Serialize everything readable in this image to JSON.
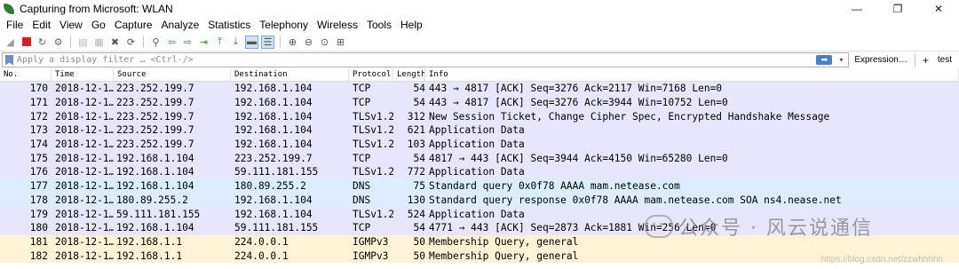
{
  "window": {
    "title": "Capturing from Microsoft: WLAN",
    "minimize": "—",
    "maximize": "❐",
    "close": "✕"
  },
  "menu": [
    "File",
    "Edit",
    "View",
    "Go",
    "Capture",
    "Analyze",
    "Statistics",
    "Telephony",
    "Wireless",
    "Tools",
    "Help"
  ],
  "toolbar_icons": [
    "shark-fin-icon",
    "stop-capture-icon",
    "restart-capture-icon",
    "capture-options-icon",
    "open-file-icon",
    "save-file-icon",
    "close-file-icon",
    "reload-icon",
    "find-packet-icon",
    "go-back-icon",
    "go-forward-icon",
    "go-to-packet-icon",
    "go-first-icon",
    "go-last-icon",
    "auto-scroll-icon",
    "colorize-icon",
    "zoom-in-icon",
    "zoom-out-icon",
    "zoom-normal-icon",
    "resize-columns-icon"
  ],
  "filter": {
    "placeholder": "Apply a display filter … <Ctrl-/>",
    "expression_label": "Expression…",
    "plus_label": "+",
    "test_label": "test"
  },
  "columns": {
    "no": "No.",
    "time": "Time",
    "source": "Source",
    "destination": "Destination",
    "protocol": "Protocol",
    "length": "Length",
    "info": "Info"
  },
  "packets": [
    {
      "no": "170",
      "time": "2018-12-1…",
      "source": "223.252.199.7",
      "destination": "192.168.1.104",
      "protocol": "TCP",
      "length": "54",
      "info": "443 → 4817 [ACK] Seq=3276 Ack=2117 Win=7168 Len=0",
      "color": "#e7e6ff"
    },
    {
      "no": "171",
      "time": "2018-12-1…",
      "source": "223.252.199.7",
      "destination": "192.168.1.104",
      "protocol": "TCP",
      "length": "54",
      "info": "443 → 4817 [ACK] Seq=3276 Ack=3944 Win=10752 Len=0",
      "color": "#e7e6ff"
    },
    {
      "no": "172",
      "time": "2018-12-1…",
      "source": "223.252.199.7",
      "destination": "192.168.1.104",
      "protocol": "TLSv1.2",
      "length": "312",
      "info": "New Session Ticket, Change Cipher Spec, Encrypted Handshake Message",
      "color": "#e7e6ff"
    },
    {
      "no": "173",
      "time": "2018-12-1…",
      "source": "223.252.199.7",
      "destination": "192.168.1.104",
      "protocol": "TLSv1.2",
      "length": "621",
      "info": "Application Data",
      "color": "#e7e6ff"
    },
    {
      "no": "174",
      "time": "2018-12-1…",
      "source": "223.252.199.7",
      "destination": "192.168.1.104",
      "protocol": "TLSv1.2",
      "length": "103",
      "info": "Application Data",
      "color": "#e7e6ff"
    },
    {
      "no": "175",
      "time": "2018-12-1…",
      "source": "192.168.1.104",
      "destination": "223.252.199.7",
      "protocol": "TCP",
      "length": "54",
      "info": "4817 → 443 [ACK] Seq=3944 Ack=4150 Win=65280 Len=0",
      "color": "#e7e6ff"
    },
    {
      "no": "176",
      "time": "2018-12-1…",
      "source": "192.168.1.104",
      "destination": "59.111.181.155",
      "protocol": "TLSv1.2",
      "length": "772",
      "info": "Application Data",
      "color": "#e7e6ff"
    },
    {
      "no": "177",
      "time": "2018-12-1…",
      "source": "192.168.1.104",
      "destination": "180.89.255.2",
      "protocol": "DNS",
      "length": "75",
      "info": "Standard query 0x0f78 AAAA mam.netease.com",
      "color": "#daeeff"
    },
    {
      "no": "178",
      "time": "2018-12-1…",
      "source": "180.89.255.2",
      "destination": "192.168.1.104",
      "protocol": "DNS",
      "length": "130",
      "info": "Standard query response 0x0f78 AAAA mam.netease.com SOA ns4.nease.net",
      "color": "#daeeff"
    },
    {
      "no": "179",
      "time": "2018-12-1…",
      "source": "59.111.181.155",
      "destination": "192.168.1.104",
      "protocol": "TLSv1.2",
      "length": "524",
      "info": "Application Data",
      "color": "#e7e6ff"
    },
    {
      "no": "180",
      "time": "2018-12-1…",
      "source": "192.168.1.104",
      "destination": "59.111.181.155",
      "protocol": "TCP",
      "length": "54",
      "info": "4771 → 443 [ACK] Seq=2873 Ack=1881 Win=256 Len=0",
      "color": "#e7e6ff"
    },
    {
      "no": "181",
      "time": "2018-12-1…",
      "source": "192.168.1.1",
      "destination": "224.0.0.1",
      "protocol": "IGMPv3",
      "length": "50",
      "info": "Membership Query, general",
      "color": "#fff3d6"
    },
    {
      "no": "182",
      "time": "2018-12-1…",
      "source": "192.168.1.1",
      "destination": "224.0.0.1",
      "protocol": "IGMPv3",
      "length": "50",
      "info": "Membership Query, general",
      "color": "#fff3d6"
    }
  ],
  "watermark": {
    "text": "公众号 · 风云说通信",
    "url": "https://blog.csdn.net/zzwhhhhh"
  }
}
